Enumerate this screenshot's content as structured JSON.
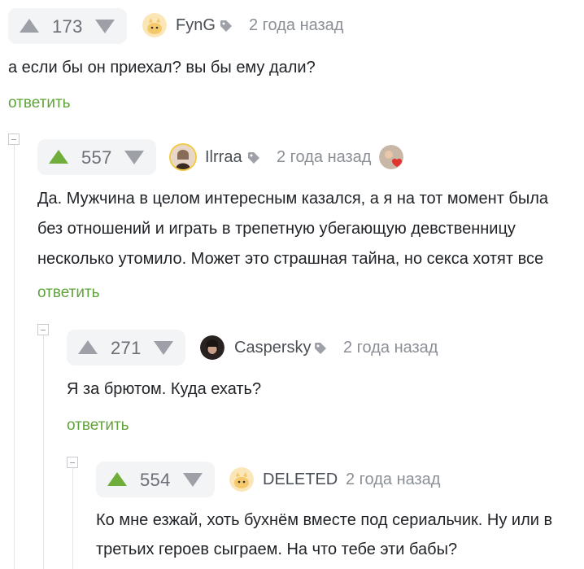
{
  "comments": [
    {
      "score": "173",
      "username": "FynG",
      "time": "2 года назад",
      "text": [
        "а если бы он приехал? вы бы ему дали?"
      ],
      "reply": "ответить",
      "up_active": false,
      "avatar": "cat-avatar-icon"
    },
    {
      "score": "557",
      "username": "Ilrraa",
      "time": "2 года назад",
      "text": [
        "Да. Мужчина в целом интересным казался, а я на тот момент была",
        "без отношений и играть в трепетную убегающую девственницу",
        "несколько утомило. Может это страшная тайна, но секса хотят все"
      ],
      "reply": "ответить",
      "up_active": true,
      "avatar": "girl-avatar-icon",
      "badge": "heart-badge-icon"
    },
    {
      "score": "271",
      "username": "Caspersky",
      "time": "2 года назад",
      "text": [
        "Я за брютом. Куда ехать?"
      ],
      "reply": "ответить",
      "up_active": false,
      "avatar": "dark-avatar-icon"
    },
    {
      "score": "554",
      "username": "DELETED",
      "time": "2 года назад",
      "text": [
        "Ко мне езжай, хоть бухнём вместе под сериальчик. Ну или в",
        "третьих героев сыграем. На что тебе эти бабы?"
      ],
      "reply": "",
      "up_active": true,
      "avatar": "cat-avatar-icon"
    }
  ],
  "colors": {
    "accent_green": "#6fae3a",
    "reply_green": "#5fa33a",
    "arrow_gray": "#9da1a7",
    "vote_bg": "#f3f4f6"
  }
}
